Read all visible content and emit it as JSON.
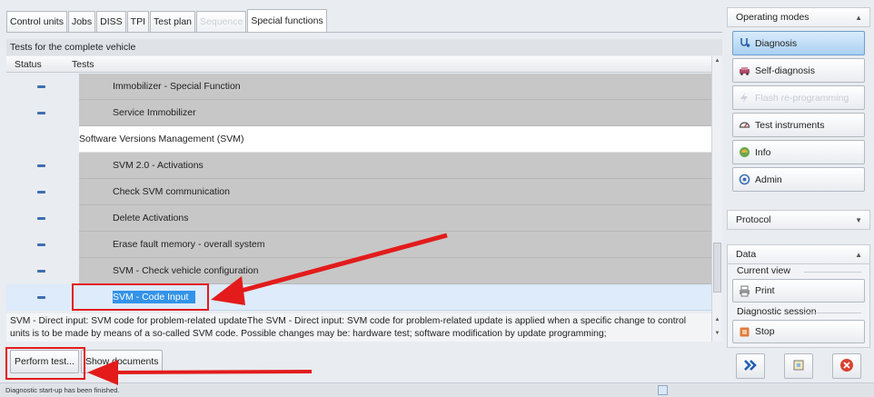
{
  "tabs": [
    {
      "label": "Control units",
      "state": "normal"
    },
    {
      "label": "Jobs",
      "state": "normal"
    },
    {
      "label": "DISS",
      "state": "normal"
    },
    {
      "label": "TPI",
      "state": "normal"
    },
    {
      "label": "Test plan",
      "state": "normal"
    },
    {
      "label": "Sequence",
      "state": "disabled"
    },
    {
      "label": "Special functions",
      "state": "active"
    }
  ],
  "main": {
    "section_title": "Tests for the complete vehicle",
    "columns": {
      "status": "Status",
      "tests": "Tests"
    },
    "rows": [
      {
        "type": "item",
        "name": "Immobilizer - Special Function"
      },
      {
        "type": "item",
        "name": "Service Immobilizer"
      },
      {
        "type": "group",
        "name": "Software Versions Management (SVM)"
      },
      {
        "type": "item",
        "name": "SVM 2.0 - Activations"
      },
      {
        "type": "item",
        "name": "Check SVM communication"
      },
      {
        "type": "item",
        "name": "Delete Activations"
      },
      {
        "type": "item",
        "name": "Erase fault memory - overall system"
      },
      {
        "type": "item",
        "name": "SVM - Check vehicle configuration"
      },
      {
        "type": "selected",
        "name": "SVM - Code Input"
      }
    ],
    "description": "SVM - Direct input: SVM code for problem-related updateThe SVM - Direct input: SVM code for problem-related update is applied when a specific change to control units is to be made by means of a so-called SVM code. Possible changes may be: hardware test; software modification by update programming;",
    "buttons": {
      "perform": "Perform test...",
      "show_docs": "Show documents"
    }
  },
  "sidebar": {
    "operating_modes": {
      "title": "Operating modes",
      "items": [
        {
          "label": "Diagnosis",
          "icon": "stethoscope-icon",
          "state": "active"
        },
        {
          "label": "Self-diagnosis",
          "icon": "car-icon",
          "state": "normal"
        },
        {
          "label": "Flash re-programming",
          "icon": "flash-icon",
          "state": "disabled"
        },
        {
          "label": "Test instruments",
          "icon": "gauge-icon",
          "state": "normal"
        },
        {
          "label": "Info",
          "icon": "info-icon",
          "state": "normal"
        },
        {
          "label": "Admin",
          "icon": "admin-icon",
          "state": "normal"
        }
      ]
    },
    "protocol": {
      "title": "Protocol"
    },
    "data": {
      "title": "Data",
      "current_view": "Current view",
      "print": "Print",
      "diagnostic_session": "Diagnostic session",
      "stop": "Stop"
    }
  },
  "statusbar": {
    "text": "Diagnostic start-up has been finished."
  },
  "colors": {
    "selection": "#3393e8",
    "annotation": "#e31b1b",
    "active_mode": "#a9d0f2"
  }
}
